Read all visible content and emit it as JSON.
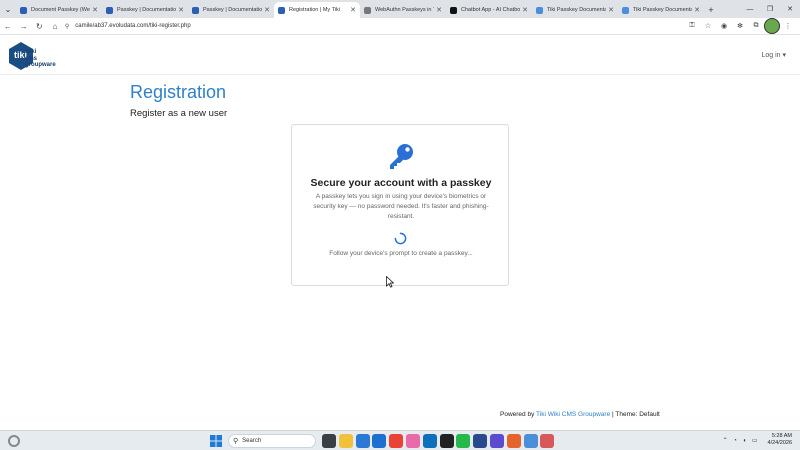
{
  "browser": {
    "tabs": [
      {
        "title": "Document Passkey (WebA",
        "fav": "#2b5fb4"
      },
      {
        "title": "Passkey | Documentation",
        "fav": "#2b5fb4"
      },
      {
        "title": "Passkey | Documentation",
        "fav": "#2b5fb4"
      },
      {
        "title": "Registration | My Tiki",
        "fav": "#2b5fb4",
        "active": true
      },
      {
        "title": "WebAuthn Passkeys in Tiki",
        "fav": "#777"
      },
      {
        "title": "Chatbot App - AI Chatbot",
        "fav": "#111"
      },
      {
        "title": "Tiki Passkey Documentati",
        "fav": "#4a8ee0"
      },
      {
        "title": "Tiki Passkey Documentati",
        "fav": "#4a8ee0"
      }
    ],
    "url": "camile/ab37.evoludata.com/tiki-register.php"
  },
  "header": {
    "logo_line1": "wiki",
    "logo_line2": "cms",
    "logo_line3": "groupware",
    "login": "Log in ▾"
  },
  "page": {
    "title": "Registration",
    "subtitle": "Register as a new user"
  },
  "card": {
    "title": "Secure your account with a passkey",
    "description": "A passkey lets you sign in using your device's biometrics or security key — no password needed. It's faster and phishing-resistant.",
    "status": "Follow your device's prompt to create a passkey..."
  },
  "footer": {
    "prefix": "Powered by",
    "link": "Tiki Wiki CMS Groupware",
    "theme": "| Theme: Default"
  },
  "taskbar": {
    "search_placeholder": "Search",
    "time": "5:28 AM",
    "date": "4/24/2026"
  },
  "colors": {
    "accent": "#2f80c8",
    "key_icon": "#2a6fd6"
  }
}
